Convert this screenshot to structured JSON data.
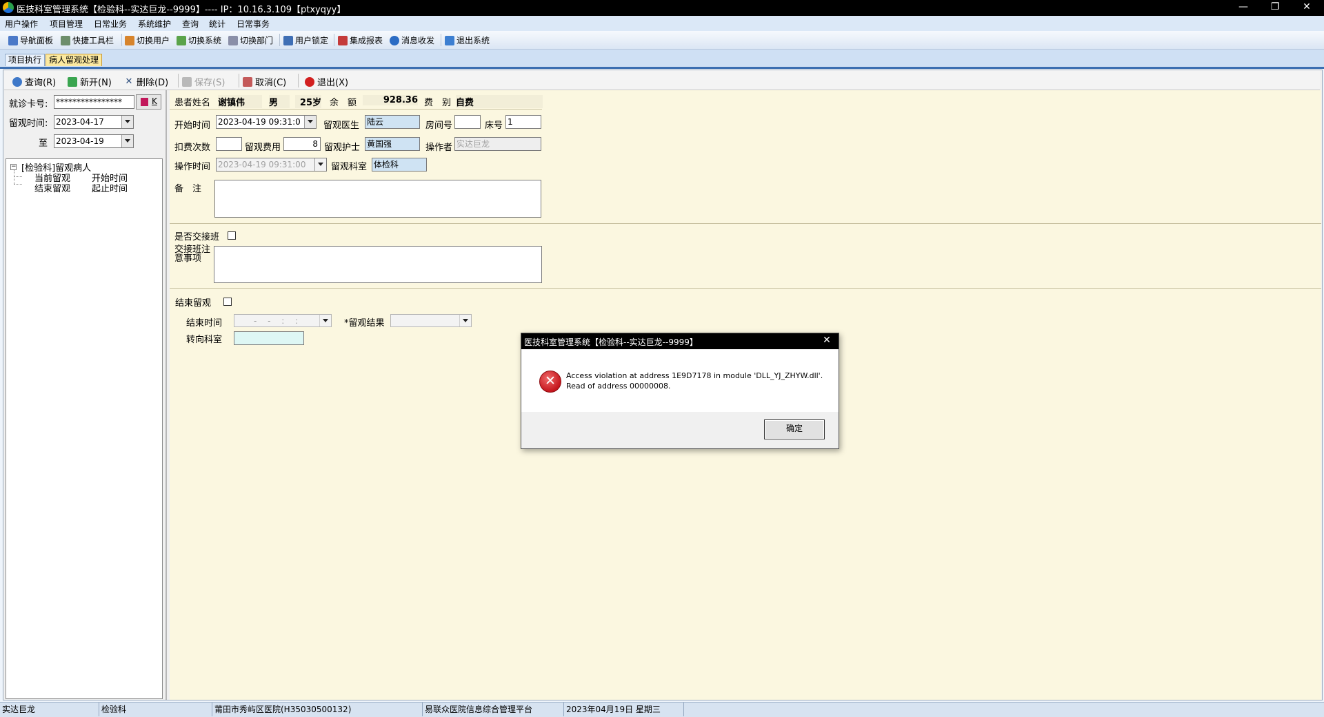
{
  "window": {
    "title": "医技科室管理系统【检验科--实达巨龙--9999】---- IP：10.16.3.109【ptxyqyy】",
    "minimize": "—",
    "restore": "❐",
    "close": "✕"
  },
  "menu": [
    "用户操作",
    "项目管理",
    "日常业务",
    "系统维护",
    "查询",
    "统计",
    "日常事务"
  ],
  "toolbar": [
    {
      "label": "导航面板",
      "icon": "dashboard-icon"
    },
    {
      "label": "快捷工具栏",
      "icon": "tools-icon"
    },
    {
      "label": "切换用户",
      "icon": "user-switch-icon"
    },
    {
      "label": "切换系统",
      "icon": "system-switch-icon"
    },
    {
      "label": "切换部门",
      "icon": "department-switch-icon"
    },
    {
      "label": "用户锁定",
      "icon": "lock-user-icon"
    },
    {
      "label": "集成报表",
      "icon": "report-icon"
    },
    {
      "label": "消息收发",
      "icon": "message-icon"
    },
    {
      "label": "退出系统",
      "icon": "exit-icon"
    }
  ],
  "tabs": [
    {
      "label": "项目执行",
      "active": false
    },
    {
      "label": "病人留观处理",
      "active": true
    }
  ],
  "actions": {
    "query": "查询(R)",
    "new": "新开(N)",
    "delete": "删除(D)",
    "save": "保存(S)",
    "cancel": "取消(C)",
    "exit": "退出(X)"
  },
  "left": {
    "card_label": "就诊卡号:",
    "card_value": "****************",
    "card_btn": "K",
    "obs_time_label": "留观时间:",
    "date_from": "2023-04-17",
    "to_label": "至",
    "date_to": "2023-04-19",
    "tree": {
      "root": "[检验科]留观病人",
      "children": [
        {
          "name": "当前留观",
          "col": "开始时间"
        },
        {
          "name": "结束留观",
          "col": "起止时间"
        }
      ]
    }
  },
  "patient": {
    "name_label": "患者姓名",
    "name": "谢镇伟",
    "sex": "男",
    "age": "25岁",
    "balance_label": "余　额",
    "balance": "928.36",
    "fee_type_label": "费　别",
    "fee_type": "自费"
  },
  "form": {
    "start_time_label": "开始时间",
    "start_time": "2023-04-19 09:31:0",
    "doctor_label": "留观医生",
    "doctor": "陆云",
    "room_label": "房间号",
    "room": "",
    "bed_label": "床号",
    "bed": "1",
    "charge_count_label": "扣费次数",
    "charge_count": "",
    "fee_label": "留观费用",
    "fee": "8",
    "nurse_label": "留观护士",
    "nurse": "黄国强",
    "operator_label": "操作者",
    "operator": "实达巨龙",
    "op_time_label": "操作时间",
    "op_time": "2023-04-19 09:31:00",
    "dept_label": "留观科室",
    "dept": "体检科",
    "remark_label": "备　注",
    "remark": "",
    "handover_label": "是否交接班",
    "handover_note_label1": "交接班注",
    "handover_note_label2": "意事项",
    "end_label": "结束留观",
    "end_time_label": "结束时间",
    "end_time": "- - : :",
    "result_label": "*留观结果",
    "result": "",
    "transfer_label": "转向科室",
    "transfer": ""
  },
  "status": [
    "实达巨龙",
    "检验科",
    "莆田市秀屿区医院(H35030500132)",
    "易联众医院信息综合管理平台",
    "2023年04月19日 星期三",
    ""
  ],
  "dialog": {
    "title": "医技科室管理系统【检验科--实达巨龙--9999】",
    "close": "✕",
    "line1": "Access violation at address 1E9D7178 in module 'DLL_YJ_ZHYW.dll'.",
    "line2": "Read of address 00000008.",
    "ok": "确定"
  }
}
